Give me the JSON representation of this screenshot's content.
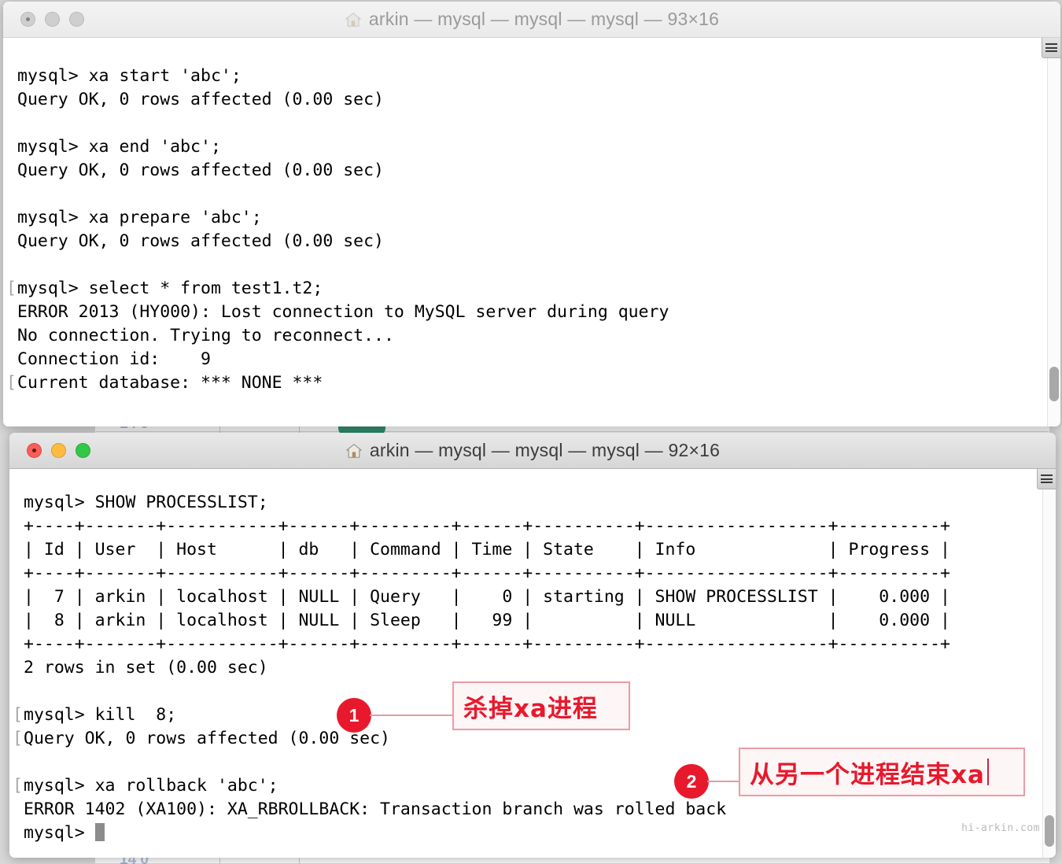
{
  "windows": [
    {
      "id": "top",
      "title": "arkin — mysql — mysql — mysql — 93×16",
      "size_label": "93×16",
      "active": false,
      "lights": {
        "close": "close",
        "minimize": "minimize",
        "zoom": "zoom"
      },
      "home_icon": "home-icon",
      "lines": [
        {
          "mark_left": "",
          "mark_right": "",
          "text": "mysql> xa start 'abc';"
        },
        {
          "mark_left": "",
          "mark_right": "",
          "text": "Query OK, 0 rows affected (0.00 sec)"
        },
        {
          "mark_left": "",
          "mark_right": "",
          "text": ""
        },
        {
          "mark_left": "",
          "mark_right": "",
          "text": "mysql> xa end 'abc';"
        },
        {
          "mark_left": "",
          "mark_right": "",
          "text": "Query OK, 0 rows affected (0.00 sec)"
        },
        {
          "mark_left": "",
          "mark_right": "",
          "text": ""
        },
        {
          "mark_left": "",
          "mark_right": "",
          "text": "mysql> xa prepare 'abc';"
        },
        {
          "mark_left": "",
          "mark_right": "",
          "text": "Query OK, 0 rows affected (0.00 sec)"
        },
        {
          "mark_left": "",
          "mark_right": "",
          "text": ""
        },
        {
          "mark_left": "[",
          "mark_right": "]",
          "text": "mysql> select * from test1.t2;"
        },
        {
          "mark_left": "",
          "mark_right": "",
          "text": "ERROR 2013 (HY000): Lost connection to MySQL server during query"
        },
        {
          "mark_left": "",
          "mark_right": "",
          "text": "No connection. Trying to reconnect..."
        },
        {
          "mark_left": "",
          "mark_right": "",
          "text": "Connection id:    9"
        },
        {
          "mark_left": "[",
          "mark_right": "]",
          "text": "Current database: *** NONE ***"
        }
      ]
    },
    {
      "id": "bottom",
      "title": "arkin — mysql — mysql — mysql — 92×16",
      "size_label": "92×16",
      "active": true,
      "lights": {
        "close": "close",
        "minimize": "minimize",
        "zoom": "zoom"
      },
      "home_icon": "home-icon",
      "lines": [
        {
          "mark_left": "",
          "mark_right": "",
          "text": "mysql> SHOW PROCESSLIST;"
        },
        {
          "mark_left": "",
          "mark_right": "",
          "text": "+----+-------+-----------+------+---------+------+----------+------------------+----------+"
        },
        {
          "mark_left": "",
          "mark_right": "",
          "text": "| Id | User  | Host      | db   | Command | Time | State    | Info             | Progress |"
        },
        {
          "mark_left": "",
          "mark_right": "",
          "text": "+----+-------+-----------+------+---------+------+----------+------------------+----------+"
        },
        {
          "mark_left": "",
          "mark_right": "",
          "text": "|  7 | arkin | localhost | NULL | Query   |    0 | starting | SHOW PROCESSLIST |    0.000 |"
        },
        {
          "mark_left": "",
          "mark_right": "",
          "text": "|  8 | arkin | localhost | NULL | Sleep   |   99 |          | NULL             |    0.000 |"
        },
        {
          "mark_left": "",
          "mark_right": "",
          "text": "+----+-------+-----------+------+---------+------+----------+------------------+----------+"
        },
        {
          "mark_left": "",
          "mark_right": "",
          "text": "2 rows in set (0.00 sec)"
        },
        {
          "mark_left": "",
          "mark_right": "",
          "text": ""
        },
        {
          "mark_left": "[",
          "mark_right": "]",
          "text": "mysql> kill  8;"
        },
        {
          "mark_left": "[",
          "mark_right": "",
          "text": "Query OK, 0 rows affected (0.00 sec)"
        },
        {
          "mark_left": "",
          "mark_right": "",
          "text": ""
        },
        {
          "mark_left": "[",
          "mark_right": "]",
          "text": "mysql> xa rollback 'abc';"
        },
        {
          "mark_left": "",
          "mark_right": "",
          "text": "ERROR 1402 (XA100): XA_RBROLLBACK: Transaction branch was rolled back"
        },
        {
          "mark_left": "",
          "mark_right": "",
          "text": "mysql> "
        }
      ],
      "prompt_cursor": "block-cursor"
    }
  ],
  "annotations": [
    {
      "number": "1",
      "text": "杀掉xa进程",
      "has_caret": false
    },
    {
      "number": "2",
      "text": "从另一个进程结束xa",
      "has_caret": true
    }
  ],
  "watermark": "hi-arkin.com",
  "colors": {
    "annotation_red": "#e8192c",
    "annotation_border": "#ef9aa4",
    "terminal_bg": "#ffffff",
    "terminal_fg": "#000000",
    "light_close": "#fc5d57",
    "light_min": "#fdbc40",
    "light_max": "#33c748"
  }
}
